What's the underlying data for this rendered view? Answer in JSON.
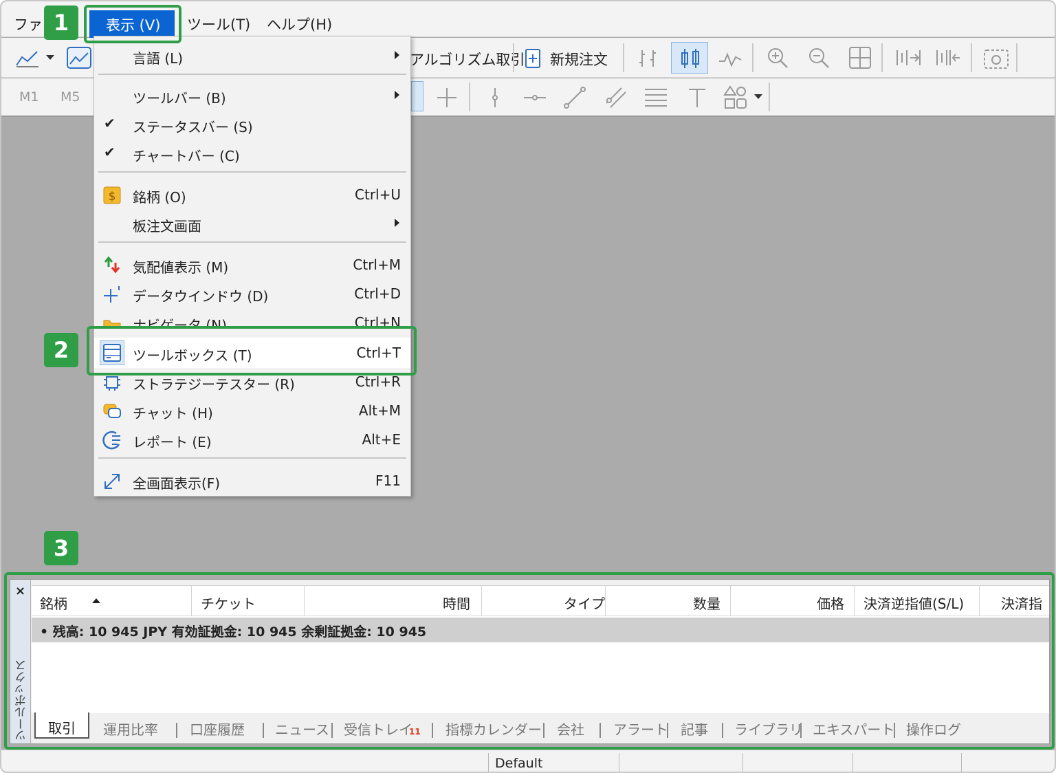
{
  "menubar": {
    "file": "ファイ",
    "view": "表示 (V)",
    "tools": "ツール(T)",
    "help": "ヘルプ(H)"
  },
  "toolbar": {
    "algo_trading": "アルゴリズム取引",
    "new_order": "新規注文",
    "timeframes": [
      "M1",
      "M5"
    ]
  },
  "view_menu": {
    "items": [
      {
        "label": "言語 (L)",
        "shortcut": "",
        "submenu": true,
        "icon": ""
      },
      {
        "label": "ツールバー (B)",
        "shortcut": "",
        "submenu": true,
        "icon": ""
      },
      {
        "label": "ステータスバー (S)",
        "shortcut": "",
        "checked": true,
        "icon": ""
      },
      {
        "label": "チャートバー (C)",
        "shortcut": "",
        "checked": true,
        "icon": ""
      },
      {
        "label": "銘柄 (O)",
        "shortcut": "Ctrl+U",
        "icon": "dollar-icon"
      },
      {
        "label": "板注文画面",
        "shortcut": "",
        "submenu": true,
        "icon": ""
      },
      {
        "label": "気配値表示 (M)",
        "shortcut": "Ctrl+M",
        "icon": "market-watch-icon"
      },
      {
        "label": "データウインドウ (D)",
        "shortcut": "Ctrl+D",
        "icon": "crosshair-icon"
      },
      {
        "label": "ナビゲータ (N)",
        "shortcut": "Ctrl+N",
        "icon": "folder-icon"
      },
      {
        "label": "ツールボックス (T)",
        "shortcut": "Ctrl+T",
        "icon": "toolbox-icon"
      },
      {
        "label": "ストラテジーテスター (R)",
        "shortcut": "Ctrl+R",
        "icon": "chip-icon"
      },
      {
        "label": "チャット (H)",
        "shortcut": "Alt+M",
        "icon": "chat-icon"
      },
      {
        "label": "レポート (E)",
        "shortcut": "Alt+E",
        "icon": "report-icon"
      },
      {
        "label": "全画面表示(F)",
        "shortcut": "F11",
        "icon": "fullscreen-icon"
      }
    ],
    "check_mark": "✔"
  },
  "badges": [
    "1",
    "2",
    "3"
  ],
  "toolbox": {
    "close": "×",
    "vertical_title": "ツールボックス",
    "columns": [
      "銘柄",
      "チケット",
      "時間",
      "タイプ",
      "数量",
      "価格",
      "決済逆指値(S/L)",
      "決済指"
    ],
    "balance_row": "•  残高: 10 945 JPY  有効証拠金: 10 945  余剰証拠金: 10 945",
    "tabs": [
      "取引",
      "運用比率",
      "口座履歴",
      "ニュース",
      "受信トレイ",
      "指標カレンダー",
      "会社",
      "アラート",
      "記事",
      "ライブラリ",
      "エキスパート",
      "操作ログ"
    ],
    "inbox_count": "11"
  },
  "statusbar": {
    "profile": "Default"
  },
  "colors": {
    "accent_green": "#2f9e47",
    "menu_selected": "#0a64d2",
    "chart_area": "#ababab"
  }
}
